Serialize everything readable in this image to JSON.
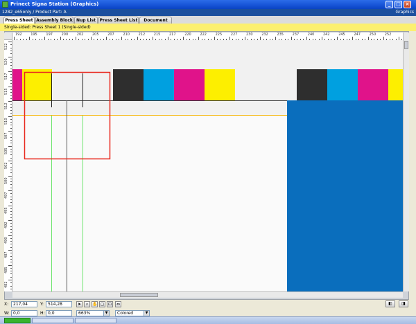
{
  "window": {
    "title": "Prinect Signa Station (Graphics)",
    "subtitle": "1282_e65only / Product Part: A",
    "mode": "Graphics",
    "buttons": {
      "minimize": "_",
      "maximize": "□",
      "close": "×"
    }
  },
  "tabs": [
    {
      "label": "Press Sheet",
      "active": true
    },
    {
      "label": "Assembly Block",
      "active": false
    },
    {
      "label": "Nup List",
      "active": false
    },
    {
      "label": "Press Sheet List",
      "active": false
    },
    {
      "label": "Document",
      "active": false
    }
  ],
  "sheet_header": "Single-sided:  Press Sheet 1 (Single-sided)",
  "ruler": {
    "top_labels": [
      "192",
      "195",
      "197",
      "200",
      "202",
      "205",
      "207",
      "210",
      "212",
      "215",
      "217",
      "220",
      "222",
      "225",
      "227",
      "230",
      "232",
      "235",
      "237",
      "240",
      "242",
      "245",
      "247",
      "250",
      "252"
    ],
    "left_labels": [
      "522",
      "520",
      "517",
      "515",
      "512",
      "510",
      "507",
      "505",
      "502",
      "500",
      "497",
      "495",
      "492",
      "490",
      "487",
      "485",
      "482"
    ]
  },
  "colors": {
    "cyan": "#00a0e0",
    "magenta": "#e0138a",
    "yellow": "#fdef00",
    "black": "#2e2e2e",
    "blue_area": "#0a6ebd",
    "selection": "#e8281e",
    "guide_green": "#6ee56e",
    "guide_orange": "#f5b400"
  },
  "bottom": {
    "x_label": "X:",
    "x_value": "217,04",
    "y_label": "Y:",
    "y_value": "514,28",
    "w_label": "W:",
    "w_value": "0,0",
    "h_label": "H:",
    "h_value": "0,0",
    "zoom": "663%",
    "color_mode": "Colored",
    "tools": [
      "arrow-tool",
      "zoom-tool",
      "hand-tool",
      "select-tool",
      "fit-tool",
      "measure-tool"
    ]
  }
}
